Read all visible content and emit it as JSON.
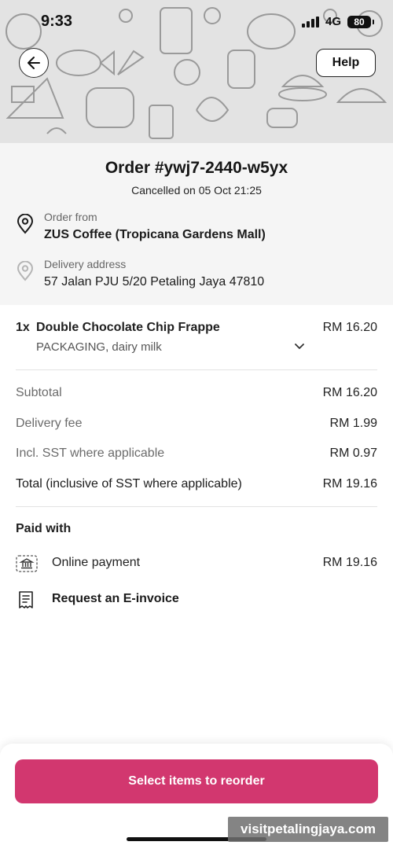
{
  "status_bar": {
    "time": "9:33",
    "network": "4G",
    "battery": "80"
  },
  "header": {
    "help_label": "Help"
  },
  "order": {
    "title": "Order #ywj7-2440-w5yx",
    "status_text": "Cancelled on 05 Oct 21:25",
    "from_label": "Order from",
    "from_value": "ZUS Coffee (Tropicana Gardens Mall)",
    "address_label": "Delivery address",
    "address_value": "57 Jalan PJU 5/20 Petaling Jaya 47810"
  },
  "items": [
    {
      "qty": "1x",
      "name": "Double Chocolate Chip Frappe",
      "price": "RM 16.20",
      "options": "PACKAGING, dairy milk"
    }
  ],
  "summary": {
    "subtotal_label": "Subtotal",
    "subtotal_value": "RM 16.20",
    "delivery_label": "Delivery fee",
    "delivery_value": "RM 1.99",
    "sst_label": "Incl. SST where applicable",
    "sst_value": "RM 0.97",
    "total_label": "Total (inclusive of SST where applicable)",
    "total_value": "RM 19.16"
  },
  "payment": {
    "section_title": "Paid with",
    "method": "Online payment",
    "amount": "RM 19.16",
    "einvoice_label": "Request an E-invoice"
  },
  "footer": {
    "reorder_label": "Select items to reorder"
  },
  "watermark": "visitpetalingjaya.com",
  "colors": {
    "accent": "#d2376f",
    "hero_bg": "#e3e3e3",
    "order_bg": "#f5f5f5"
  },
  "icons": [
    "back-arrow-icon",
    "location-pin-icon",
    "chevron-down-icon",
    "bank-icon",
    "receipt-icon",
    "signal-icon",
    "battery-icon"
  ]
}
